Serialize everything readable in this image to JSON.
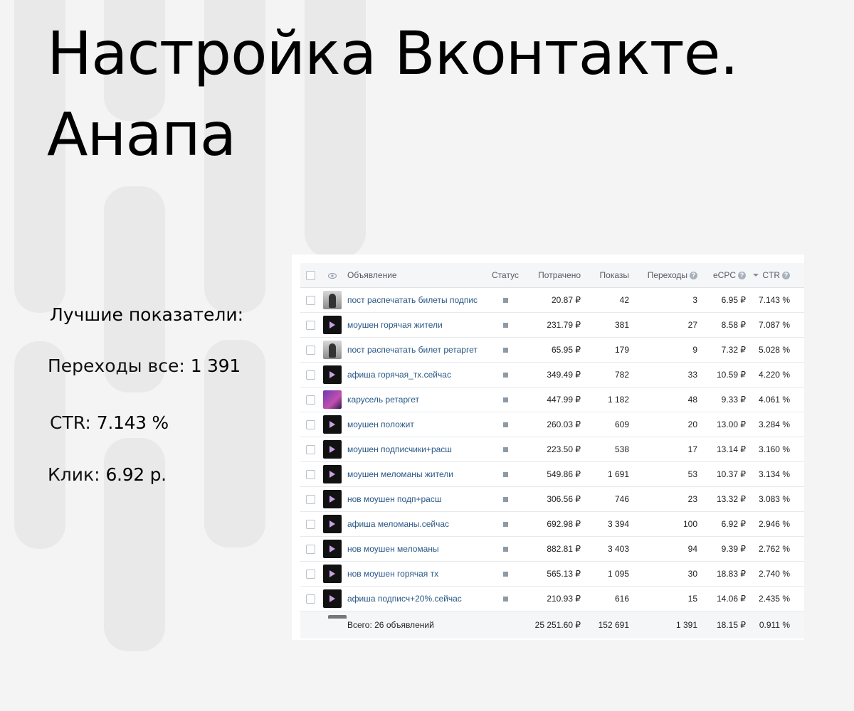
{
  "title_line1": "Настройка Вконтакте.",
  "title_line2": "Анапа",
  "stats": {
    "heading": "Лучшие показатели:",
    "clicks_label": "Переходы все:",
    "clicks_value": "1 391",
    "ctr_label": "CTR:",
    "ctr_value": "7.143 %",
    "cpc_label": "Клик:",
    "cpc_value": "6.92 р."
  },
  "table": {
    "headers": {
      "ad": "Объявление",
      "status": "Статус",
      "spent": "Потрачено",
      "views": "Показы",
      "clicks": "Переходы",
      "ecpc": "eCPC",
      "ctr": "CTR"
    },
    "rows": [
      {
        "thumb": "gray",
        "name": "пост распечатать билеты подпис",
        "spent": "20.87 ₽",
        "views": "42",
        "clicks": "3",
        "ecpc": "6.95 ₽",
        "ctr": "7.143 %"
      },
      {
        "thumb": "dark",
        "name": "моушен горячая жители",
        "spent": "231.79 ₽",
        "views": "381",
        "clicks": "27",
        "ecpc": "8.58 ₽",
        "ctr": "7.087 %"
      },
      {
        "thumb": "gray",
        "name": "пост распечатать билет ретаргет",
        "spent": "65.95 ₽",
        "views": "179",
        "clicks": "9",
        "ecpc": "7.32 ₽",
        "ctr": "5.028 %"
      },
      {
        "thumb": "dark",
        "name": "афиша горячая_тх.сейчас",
        "spent": "349.49 ₽",
        "views": "782",
        "clicks": "33",
        "ecpc": "10.59 ₽",
        "ctr": "4.220 %"
      },
      {
        "thumb": "purple",
        "name": "карусель ретаргет",
        "spent": "447.99 ₽",
        "views": "1 182",
        "clicks": "48",
        "ecpc": "9.33 ₽",
        "ctr": "4.061 %"
      },
      {
        "thumb": "dark",
        "name": "моушен положит",
        "spent": "260.03 ₽",
        "views": "609",
        "clicks": "20",
        "ecpc": "13.00 ₽",
        "ctr": "3.284 %"
      },
      {
        "thumb": "dark",
        "name": "моушен подписчики+расш",
        "spent": "223.50 ₽",
        "views": "538",
        "clicks": "17",
        "ecpc": "13.14 ₽",
        "ctr": "3.160 %"
      },
      {
        "thumb": "dark",
        "name": "моушен меломаны жители",
        "spent": "549.86 ₽",
        "views": "1 691",
        "clicks": "53",
        "ecpc": "10.37 ₽",
        "ctr": "3.134 %"
      },
      {
        "thumb": "dark",
        "name": "нов моушен подп+расш",
        "spent": "306.56 ₽",
        "views": "746",
        "clicks": "23",
        "ecpc": "13.32 ₽",
        "ctr": "3.083 %"
      },
      {
        "thumb": "dark",
        "name": "афиша меломаны.сейчас",
        "spent": "692.98 ₽",
        "views": "3 394",
        "clicks": "100",
        "ecpc": "6.92 ₽",
        "ctr": "2.946 %"
      },
      {
        "thumb": "dark",
        "name": "нов моушен меломаны",
        "spent": "882.81 ₽",
        "views": "3 403",
        "clicks": "94",
        "ecpc": "9.39 ₽",
        "ctr": "2.762 %"
      },
      {
        "thumb": "dark",
        "name": "нов моушен горячая тх",
        "spent": "565.13 ₽",
        "views": "1 095",
        "clicks": "30",
        "ecpc": "18.83 ₽",
        "ctr": "2.740 %"
      },
      {
        "thumb": "dark",
        "name": "афиша подписч+20%.сейчас",
        "spent": "210.93 ₽",
        "views": "616",
        "clicks": "15",
        "ecpc": "14.06 ₽",
        "ctr": "2.435 %"
      }
    ],
    "totals": {
      "label": "Всего: 26 объявлений",
      "spent": "25 251.60 ₽",
      "views": "152 691",
      "clicks": "1 391",
      "ecpc": "18.15 ₽",
      "ctr": "0.911 %"
    }
  }
}
